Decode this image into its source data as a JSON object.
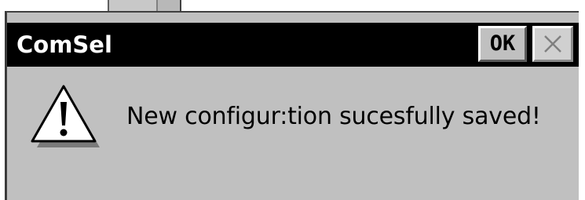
{
  "dialog": {
    "title": "ComSel",
    "ok_label": "OK",
    "close_icon": "close-icon",
    "warning_icon": "warning-icon",
    "message": "New configur:tion sucesfully saved!"
  },
  "colors": {
    "titlebar": "#000000",
    "title_text": "#ffffff",
    "dialog_bg": "#c0c0c0",
    "button_face": "#c0c0c0"
  }
}
